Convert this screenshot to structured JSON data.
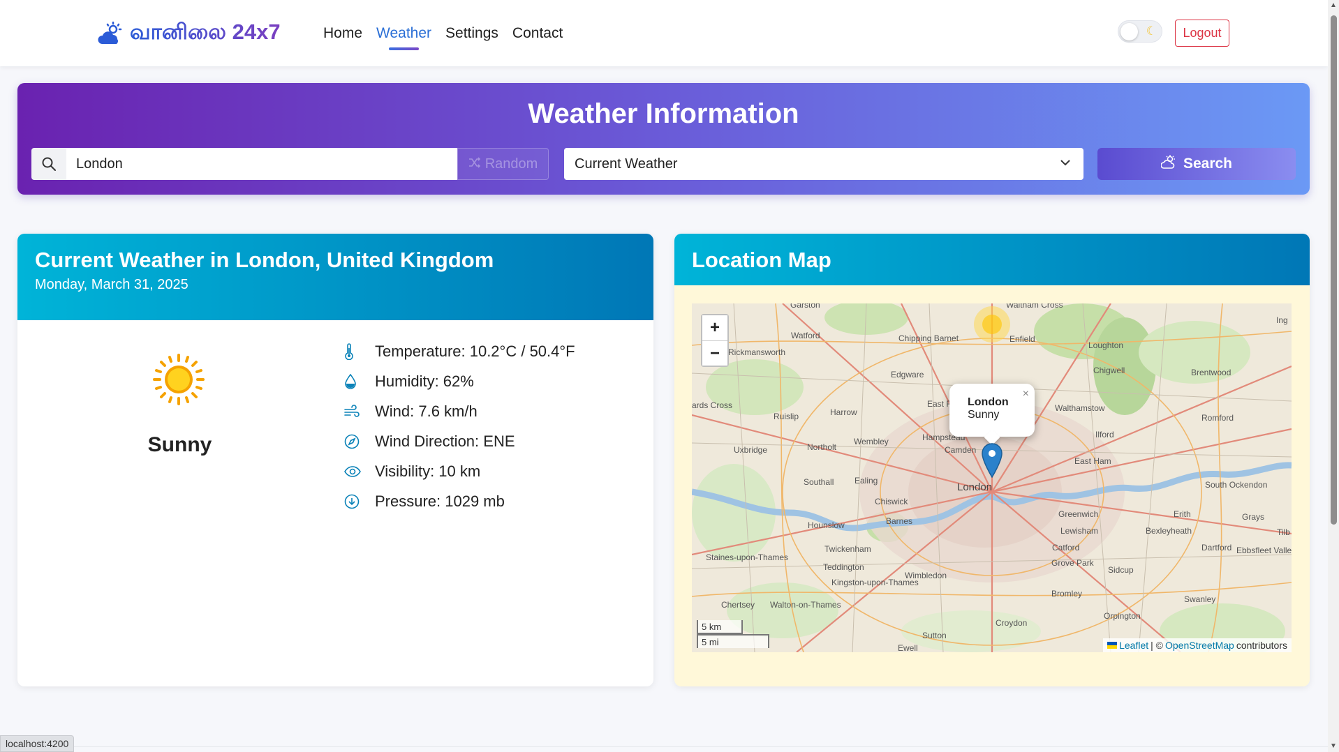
{
  "navbar": {
    "brand": "வானிலை 24x7",
    "links": [
      {
        "label": "Home"
      },
      {
        "label": "Weather"
      },
      {
        "label": "Settings"
      },
      {
        "label": "Contact"
      }
    ],
    "active_link": "Weather",
    "logout_label": "Logout",
    "theme_toggle_icon": "moon-icon"
  },
  "hero": {
    "title": "Weather Information",
    "search_value": "London",
    "random_label": "Random",
    "select_value": "Current Weather",
    "search_button_label": "Search"
  },
  "weather": {
    "title": "Current Weather in London, United Kingdom",
    "date": "Monday, March 31, 2025",
    "condition": "Sunny",
    "condition_icon": "sun-icon",
    "details": [
      {
        "icon": "thermometer-icon",
        "text": "Temperature: 10.2°C / 50.4°F"
      },
      {
        "icon": "droplet-icon",
        "text": "Humidity: 62%"
      },
      {
        "icon": "wind-icon",
        "text": "Wind: 7.6 km/h"
      },
      {
        "icon": "compass-icon",
        "text": "Wind Direction: ENE"
      },
      {
        "icon": "eye-icon",
        "text": "Visibility: 10 km"
      },
      {
        "icon": "arrow-down-circle-icon",
        "text": "Pressure: 1029 mb"
      }
    ]
  },
  "map": {
    "title": "Location Map",
    "zoom_in": "+",
    "zoom_out": "−",
    "popup_name": "London",
    "popup_condition": "Sunny",
    "popup_close": "×",
    "scale_km": "5 km",
    "scale_mi": "5 mi",
    "attribution_leaflet": "Leaflet",
    "attribution_sep": "| ©",
    "attribution_osm": "OpenStreetMap",
    "attribution_suffix": "contributors",
    "place_labels": [
      "Garston",
      "Waltham Cross",
      "Watford",
      "Chipping Barnet",
      "Enfield",
      "Loughton",
      "Rickmansworth",
      "Edgware",
      "Chigwell",
      "Brentwood",
      "Harrow",
      "East Finchley",
      "Walthamstow",
      "Romford",
      "Ruislip",
      "Hampstead",
      "Camden",
      "Ilford",
      "Uxbridge",
      "Northolt",
      "Wembley",
      "East Ham",
      "Southall",
      "Ealing",
      "London",
      "South Ockendon",
      "Chiswick",
      "Greenwich",
      "Erith",
      "Grays",
      "Barnes",
      "Hounslow",
      "Lewisham",
      "Bexleyheath",
      "Catford",
      "Dartford",
      "Ebbsfleet Valley",
      "Twickenham",
      "Grove Park",
      "Sidcup",
      "Staines-upon-Thames",
      "Teddington",
      "Kingston-upon-Thames",
      "Wimbledon",
      "Bromley",
      "Swanley",
      "Chertsey",
      "Walton-on-Thames",
      "Orpington",
      "Croydon",
      "Sutton",
      "Ewell",
      "Ing",
      "Tilb",
      "ards Cross"
    ]
  },
  "status": {
    "url": "localhost:4200"
  },
  "colors": {
    "accent": "#2b6fd6",
    "hero_start": "#6a22b0",
    "hero_end": "#6b99f5",
    "card_header_start": "#00b4d8",
    "card_header_end": "#0077b6",
    "logout": "#dc3545"
  }
}
